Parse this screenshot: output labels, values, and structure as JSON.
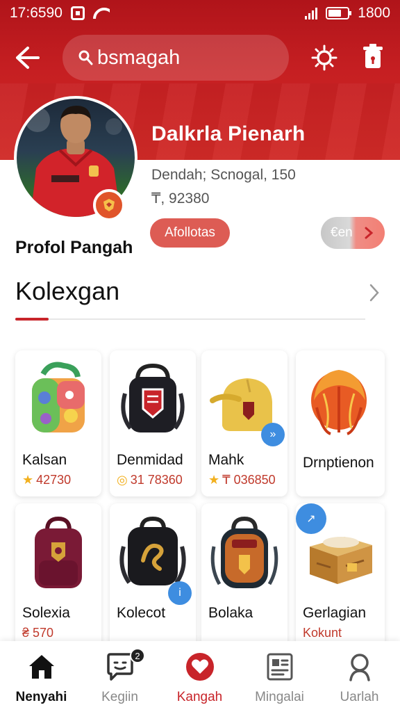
{
  "status_bar": {
    "time": "17:6590",
    "right_text": "1800"
  },
  "header": {
    "search_value": "bsmagah",
    "colors": {
      "brand": "#c61f22",
      "accent": "#dd5c54"
    }
  },
  "profile": {
    "name": "Dalkrla Pienarh",
    "meta": "Dendah; Scnogal, 150",
    "id": "₸, 92380",
    "follow_label": "Afollotas",
    "share_label": "€en",
    "caption": "Profol Pangah"
  },
  "section": {
    "title": "Kolexgan"
  },
  "collection": [
    {
      "title": "Kalsan",
      "price": "42730",
      "price_icon": "star-icon",
      "art": "colorful-backpack"
    },
    {
      "title": "Denmidad",
      "price": "31 78360",
      "price_icon": "coin-icon",
      "art": "black-crest-bag"
    },
    {
      "title": "Mahk",
      "price": "₸ 036850",
      "price_icon": "star-icon",
      "art": "yellow-cap-bag",
      "badge": "»"
    },
    {
      "title": "Drnptienon",
      "price": "",
      "price_icon": "",
      "art": "orange-wig"
    },
    {
      "title": "Solexia",
      "price": "₴ 570",
      "price_icon": "",
      "art": "maroon-backpack"
    },
    {
      "title": "Kolecot",
      "price": "",
      "price_icon": "",
      "art": "black-dragon-bag",
      "badge": "i"
    },
    {
      "title": "Bolaka",
      "price": "",
      "price_icon": "",
      "art": "brown-crest-backpack"
    },
    {
      "title": "Gerlagian",
      "price": "Kokunt",
      "price_icon": "",
      "art": "wooden-box",
      "badge": "↗"
    }
  ],
  "bottom_nav": [
    {
      "label": "Nenyahi",
      "icon": "home-icon"
    },
    {
      "label": "Kegiin",
      "icon": "chat-icon",
      "badge": "2"
    },
    {
      "label": "Kangah",
      "icon": "heart-icon"
    },
    {
      "label": "Mingalai",
      "icon": "news-icon"
    },
    {
      "label": "Uarlah",
      "icon": "search-icon"
    }
  ]
}
